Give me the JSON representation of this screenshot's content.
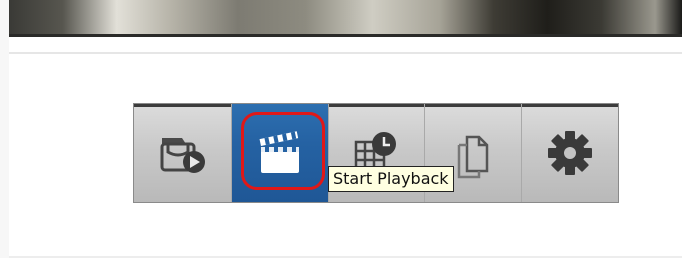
{
  "toolbar": {
    "buttons": [
      {
        "name": "playback-from-archive",
        "icon": "archive-play-icon",
        "active": false
      },
      {
        "name": "start-playback",
        "icon": "clapperboard-icon",
        "active": true
      },
      {
        "name": "scheduled-playback",
        "icon": "grid-clock-icon",
        "active": false
      },
      {
        "name": "documents",
        "icon": "document-copy-icon",
        "active": false
      },
      {
        "name": "settings",
        "icon": "gear-icon",
        "active": false
      }
    ]
  },
  "tooltip": {
    "text": "Start Playback"
  },
  "colors": {
    "active_button": "#2562a3",
    "highlight": "#e01818",
    "icon": "#3f3f3f",
    "tooltip_bg": "#ffffe1"
  }
}
